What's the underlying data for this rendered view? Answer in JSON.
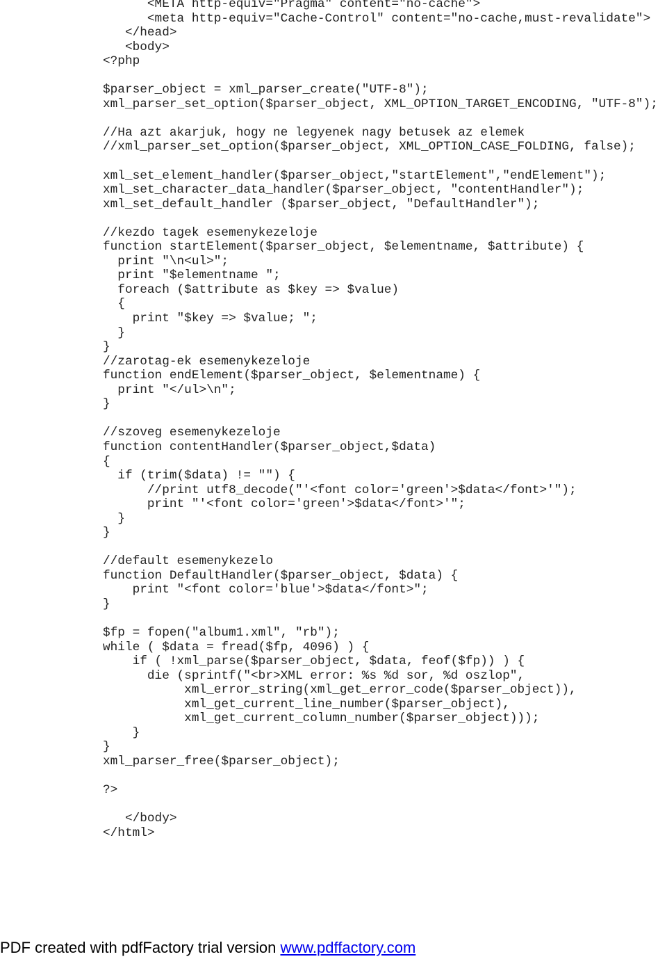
{
  "document": {
    "code_lines": [
      "      <META http-equiv=\"Pragma\" content=\"no-cache\">",
      "      <meta http-equiv=\"Cache-Control\" content=\"no-cache,must-revalidate\">",
      "   </head>",
      "   <body>",
      "<?php",
      "",
      "$parser_object = xml_parser_create(\"UTF-8\");",
      "xml_parser_set_option($parser_object, XML_OPTION_TARGET_ENCODING, \"UTF-8\");",
      "",
      "//Ha azt akarjuk, hogy ne legyenek nagy betusek az elemek",
      "//xml_parser_set_option($parser_object, XML_OPTION_CASE_FOLDING, false);",
      "",
      "xml_set_element_handler($parser_object,\"startElement\",\"endElement\");",
      "xml_set_character_data_handler($parser_object, \"contentHandler\");",
      "xml_set_default_handler ($parser_object, \"DefaultHandler\");",
      "",
      "//kezdo tagek esemenykezeloje",
      "function startElement($parser_object, $elementname, $attribute) {",
      "  print \"\\n<ul>\";",
      "  print \"$elementname \";",
      "  foreach ($attribute as $key => $value)",
      "  {",
      "    print \"$key => $value; \";",
      "  }",
      "}",
      "//zarotag-ek esemenykezeloje",
      "function endElement($parser_object, $elementname) {",
      "  print \"</ul>\\n\";",
      "}",
      "",
      "//szoveg esemenykezeloje",
      "function contentHandler($parser_object,$data)",
      "{",
      "  if (trim($data) != \"\") {",
      "      //print utf8_decode(\"'<font color='green'>$data</font>'\");",
      "      print \"'<font color='green'>$data</font>'\";",
      "  }",
      "}",
      "",
      "//default esemenykezelo",
      "function DefaultHandler($parser_object, $data) {",
      "    print \"<font color='blue'>$data</font>\";",
      "}",
      "",
      "$fp = fopen(\"album1.xml\", \"rb\");",
      "while ( $data = fread($fp, 4096) ) {",
      "    if ( !xml_parse($parser_object, $data, feof($fp)) ) {",
      "      die (sprintf(\"<br>XML error: %s %d sor, %d oszlop\",",
      "           xml_error_string(xml_get_error_code($parser_object)),",
      "           xml_get_current_line_number($parser_object),",
      "           xml_get_current_column_number($parser_object)));",
      "    }",
      "}",
      "xml_parser_free($parser_object);",
      "",
      "?>",
      "",
      "   </body>",
      "</html>"
    ]
  },
  "footer": {
    "text": "PDF created with pdfFactory trial version ",
    "link_text": "www.pdffactory.com",
    "link_color": "#0000ee"
  }
}
